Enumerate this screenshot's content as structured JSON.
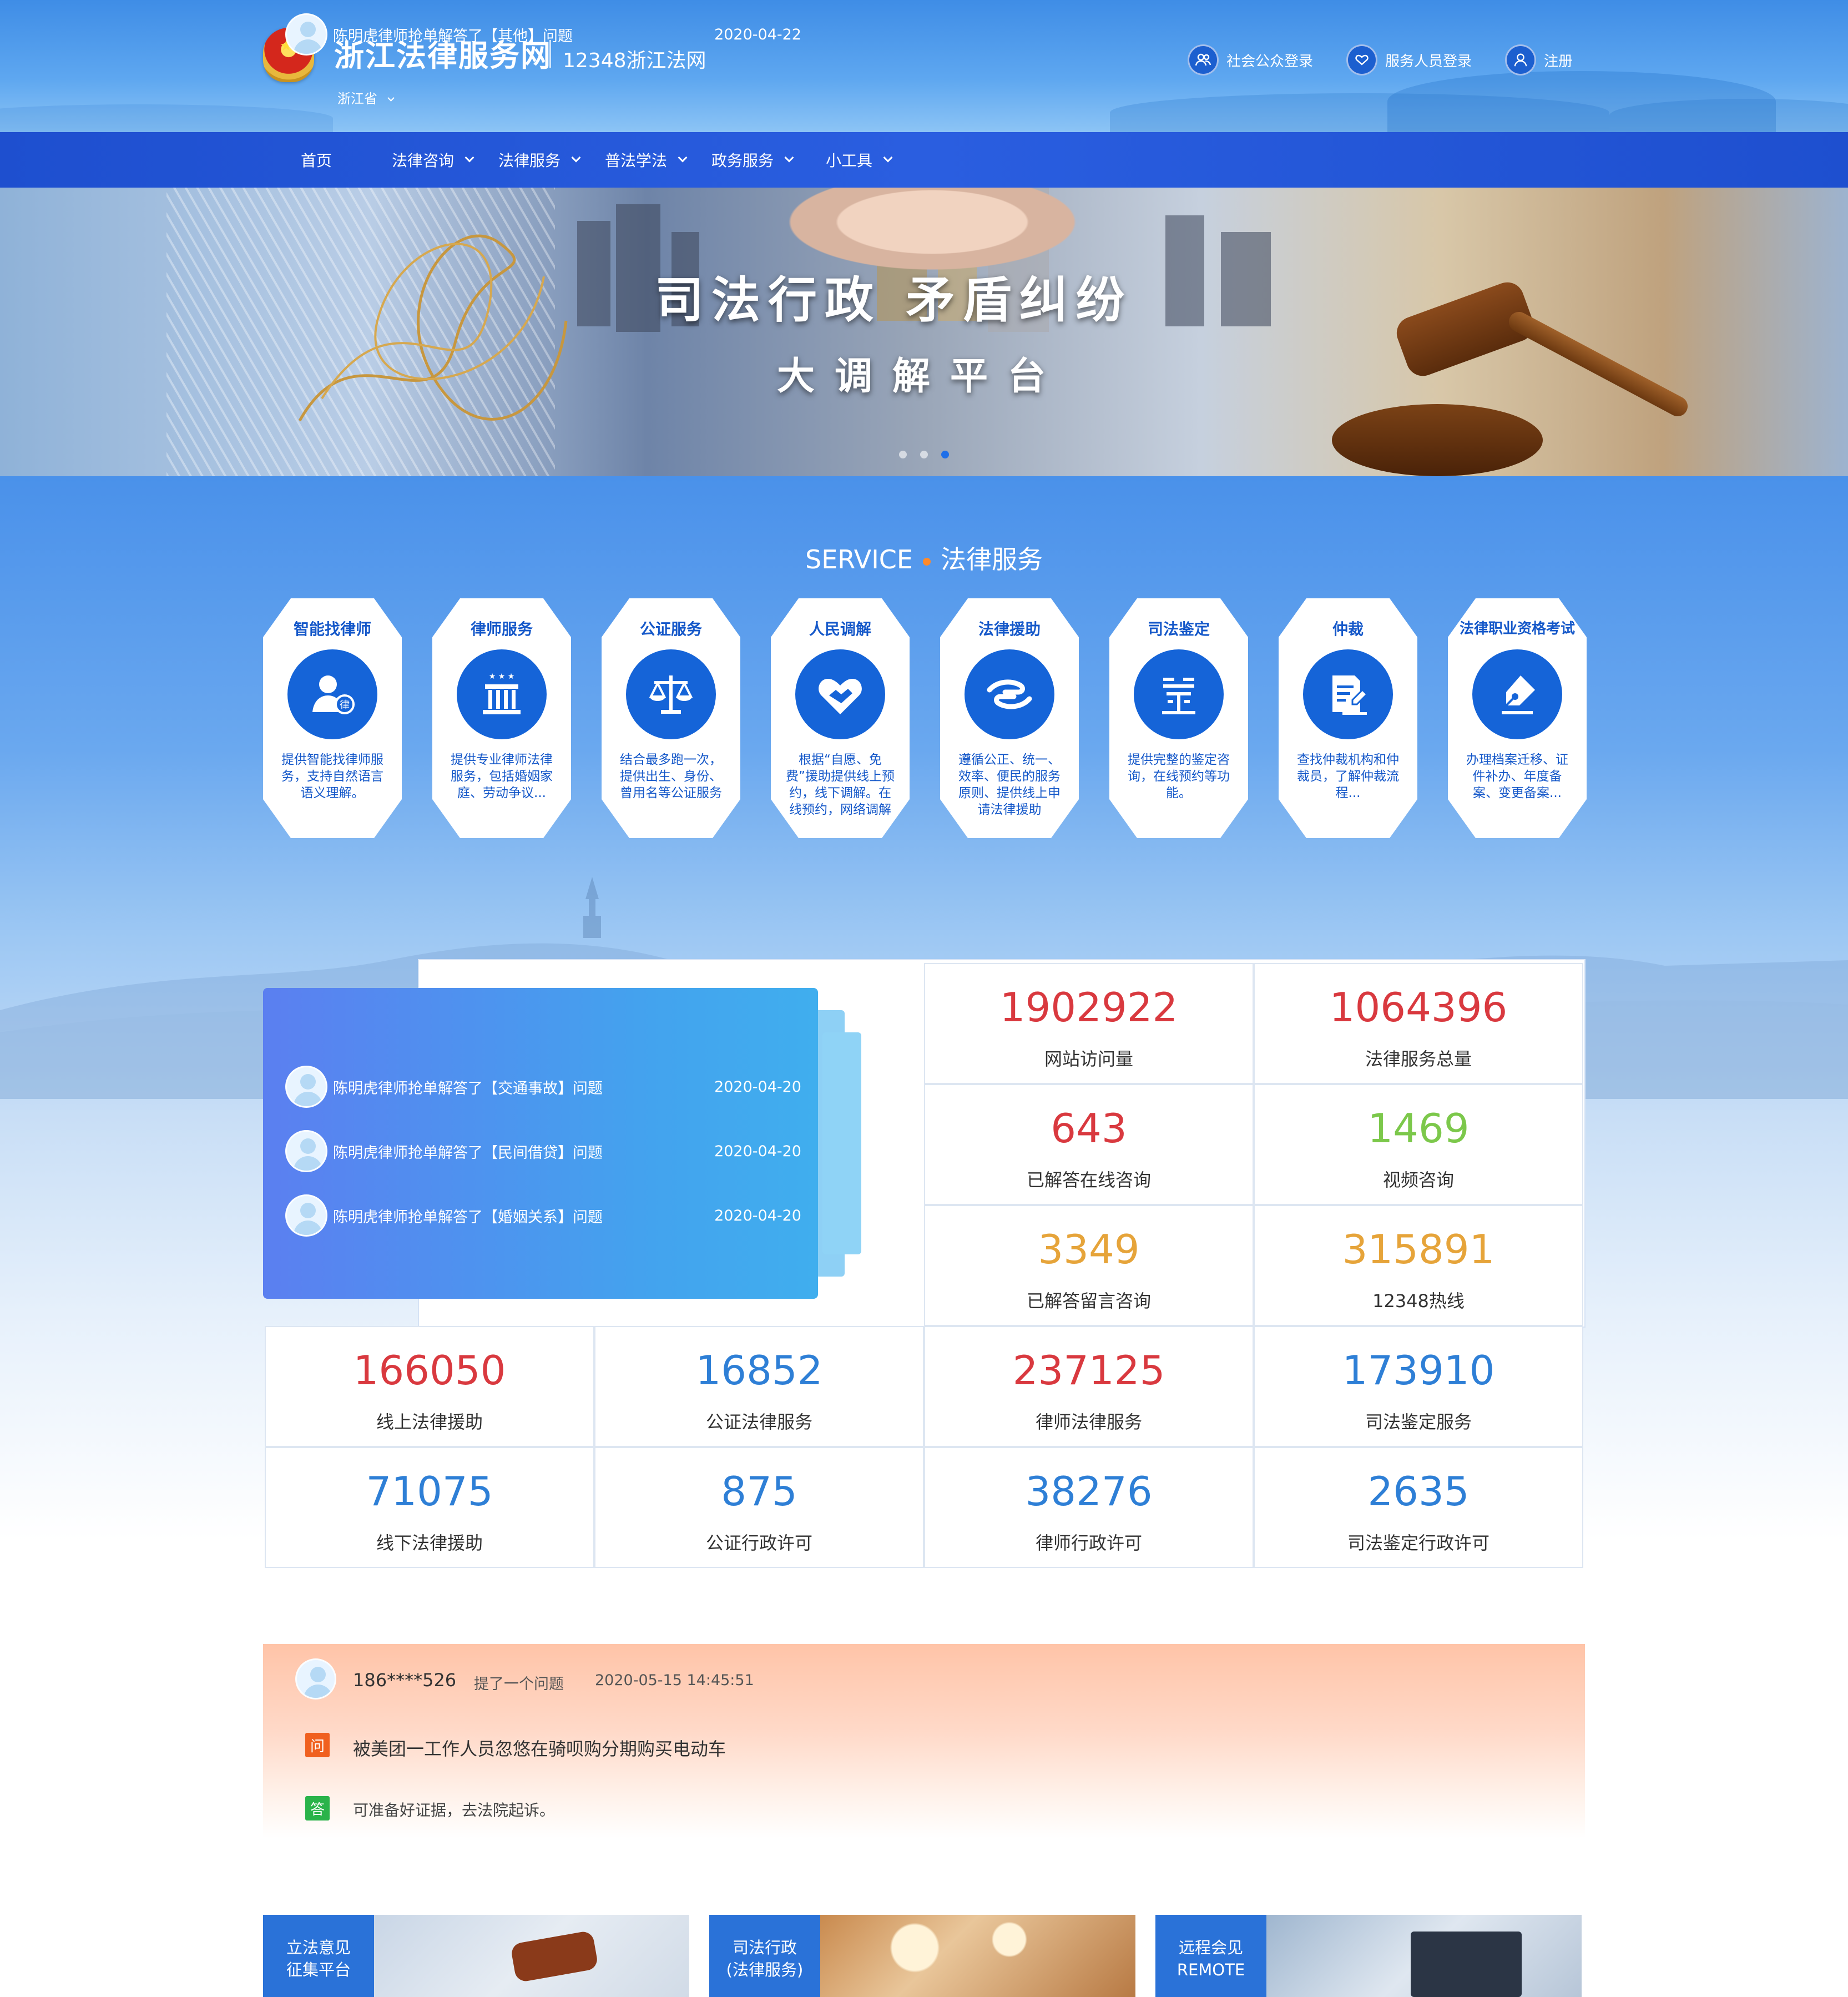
{
  "header": {
    "site_title": "浙江法律服务网",
    "site_subtitle": "12348浙江法网",
    "region": "浙江省",
    "links": [
      "社会公众登录",
      "服务人员登录",
      "注册"
    ]
  },
  "nav": {
    "items": [
      "首页",
      "法律咨询",
      "法律服务",
      "普法学法",
      "政务服务",
      "小工具"
    ]
  },
  "banner": {
    "headline": "司法行政 矛盾纠纷",
    "subheadline": "大调解平台",
    "active_slide": 3,
    "slide_count": 3
  },
  "service": {
    "title_en": "SERVICE",
    "title_cn": "法律服务",
    "cards": [
      {
        "title": "智能找律师",
        "desc": "提供智能找律师服务，支持自然语言语义理解。"
      },
      {
        "title": "律师服务",
        "desc": "提供专业律师法律服务，包括婚姻家庭、劳动争议..."
      },
      {
        "title": "公证服务",
        "desc": "结合最多跑一次，提供出生、身份、曾用名等公证服务"
      },
      {
        "title": "人民调解",
        "desc": "根据“自愿、免费”援助提供线上预约，线下调解。在线预约，网络调解"
      },
      {
        "title": "法律援助",
        "desc": "遵循公正、统一、效率、便民的服务原则、提供线上申请法律援助"
      },
      {
        "title": "司法鉴定",
        "desc": "提供完整的鉴定咨询，在线预约等功能。"
      },
      {
        "title": "仲裁",
        "desc": "查找仲裁机构和仲裁员，了解仲裁流程..."
      },
      {
        "title": "法律职业资格考试",
        "desc": "办理档案迁移、证件补办、年度备案、变更备案..."
      }
    ]
  },
  "answers": [
    {
      "text": "陈明虎律师抢单解答了【其他】问题",
      "date": "2020-04-22"
    },
    {
      "text": "陈明虎律师抢单解答了【交通事故】问题",
      "date": "2020-04-20"
    },
    {
      "text": "陈明虎律师抢单解答了【民间借贷】问题",
      "date": "2020-04-20"
    },
    {
      "text": "陈明虎律师抢单解答了【婚姻关系】问题",
      "date": "2020-04-20"
    }
  ],
  "stats": {
    "s1": {
      "value": "1902922",
      "label": "网站访问量"
    },
    "s2": {
      "value": "1064396",
      "label": "法律服务总量"
    },
    "s3": {
      "value": "643",
      "label": "已解答在线咨询"
    },
    "s4": {
      "value": "1469",
      "label": "视频咨询"
    },
    "s5": {
      "value": "3349",
      "label": "已解答留言咨询"
    },
    "s6": {
      "value": "315891",
      "label": "12348热线"
    },
    "s7": {
      "value": "166050",
      "label": "线上法律援助"
    },
    "s8": {
      "value": "16852",
      "label": "公证法律服务"
    },
    "s9": {
      "value": "237125",
      "label": "律师法律服务"
    },
    "s10": {
      "value": "173910",
      "label": "司法鉴定服务"
    },
    "s11": {
      "value": "71075",
      "label": "线下法律援助"
    },
    "s12": {
      "value": "875",
      "label": "公证行政许可"
    },
    "s13": {
      "value": "38276",
      "label": "律师行政许可"
    },
    "s14": {
      "value": "2635",
      "label": "司法鉴定行政许可"
    }
  },
  "colors": {
    "red": "#d9393f",
    "green": "#7cc84b",
    "orange": "#e6a43a",
    "blue": "#2e7fd6",
    "nav": "#1e4fcf",
    "accent_dot": "#ff8a2a"
  },
  "question": {
    "user": "186****526",
    "action": "提了一个问题",
    "time": "2020-05-15 14:45:51",
    "q_tag": "问",
    "a_tag": "答",
    "question_text": "被美团一工作人员忽悠在骑呗购分期购买电动车",
    "answer_text": "可准备好证据，去法院起诉。"
  },
  "bottom_cards": [
    {
      "line1": "立法意见",
      "line2": "征集平台"
    },
    {
      "line1": "司法行政",
      "line2": "(法律服务)"
    },
    {
      "line1": "远程会见",
      "line2": "REMOTE"
    }
  ]
}
